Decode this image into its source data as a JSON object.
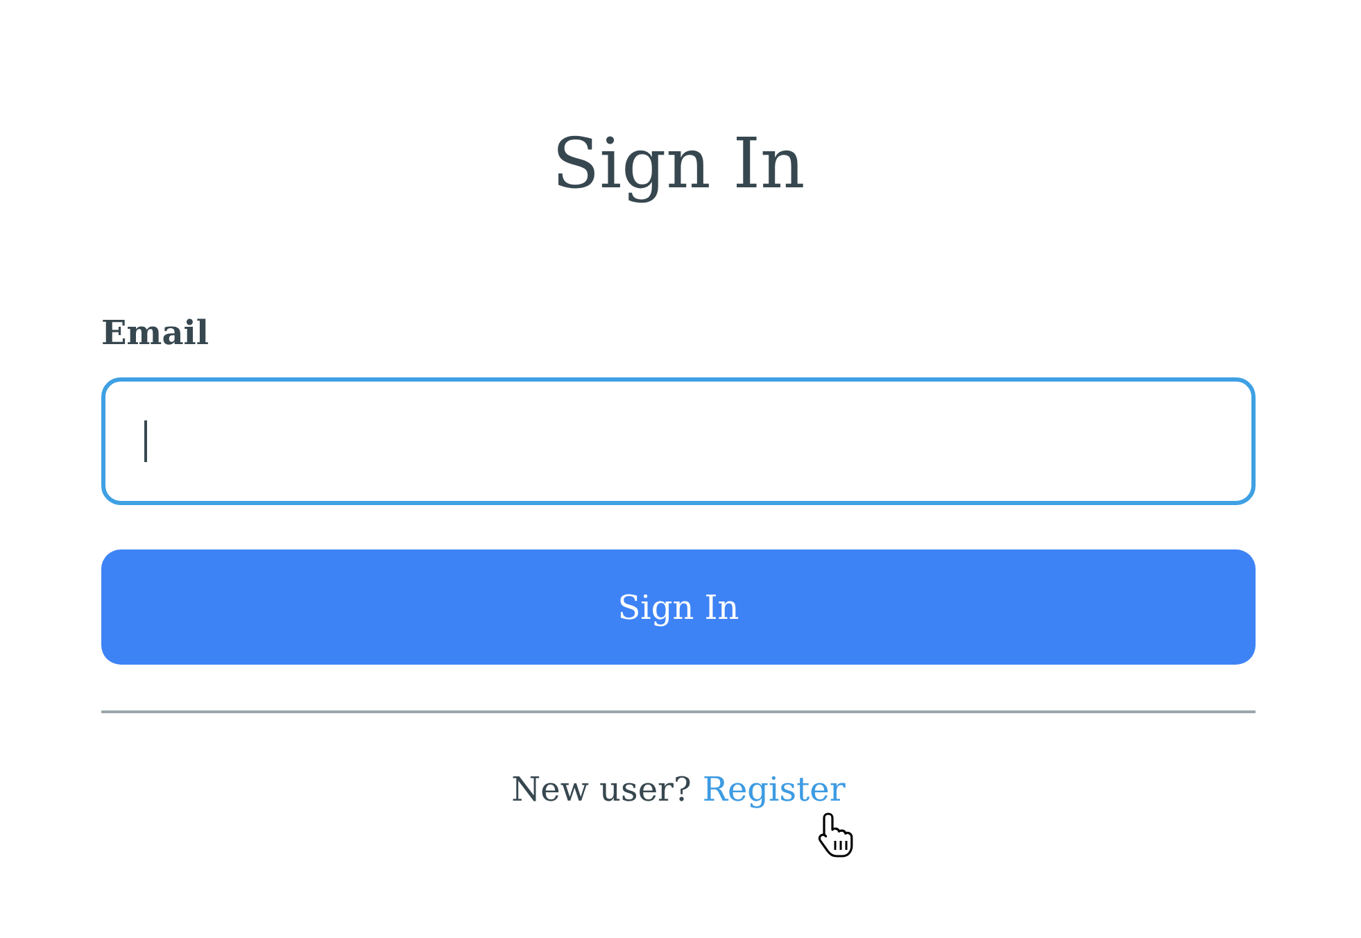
{
  "title": "Sign In",
  "form": {
    "fields": [
      {
        "label": "Email",
        "focused": true
      }
    ],
    "submit": "Sign In"
  },
  "footer": {
    "prompt": "New user?",
    "link": "Register"
  }
}
